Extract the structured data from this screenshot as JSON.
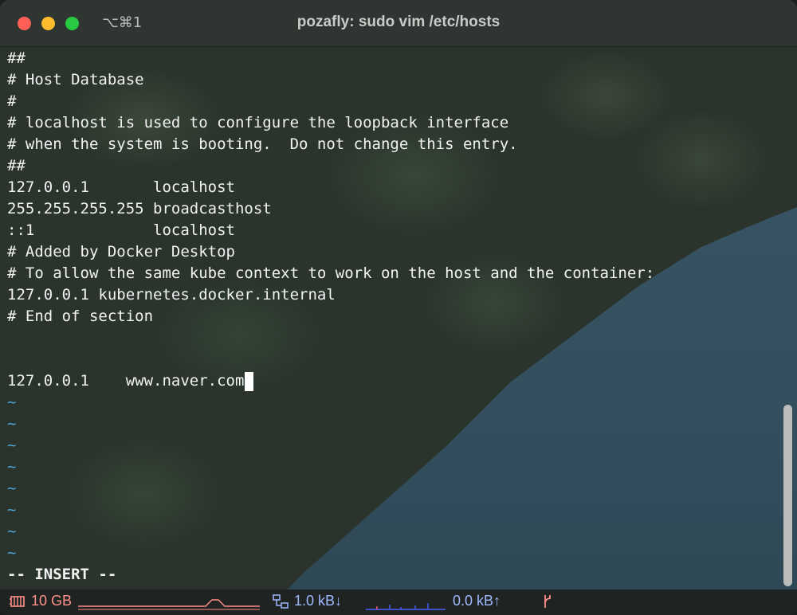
{
  "window": {
    "tab_shortcut": "⌥⌘1",
    "title": "pozafly: sudo vim /etc/hosts"
  },
  "editor": {
    "lines": [
      "##",
      "# Host Database",
      "#",
      "# localhost is used to configure the loopback interface",
      "# when the system is booting.  Do not change this entry.",
      "##",
      "127.0.0.1       localhost",
      "255.255.255.255 broadcasthost",
      "::1             localhost",
      "# Added by Docker Desktop",
      "# To allow the same kube context to work on the host and the container:",
      "127.0.0.1 kubernetes.docker.internal",
      "# End of section",
      "",
      "",
      "127.0.0.1    www.naver.com"
    ],
    "tilde": "~",
    "tilde_count": 8,
    "mode": "-- INSERT --"
  },
  "statusbar": {
    "memory": "10 GB",
    "net_down": "1.0 kB↓",
    "net_up": "0.0 kB↑",
    "icons": [
      "memory-icon",
      "network-icon",
      "git-branch-icon"
    ],
    "colors": {
      "memory": "#ff8f88",
      "network": "#9fb8ff",
      "git": "#ff8f88"
    }
  }
}
